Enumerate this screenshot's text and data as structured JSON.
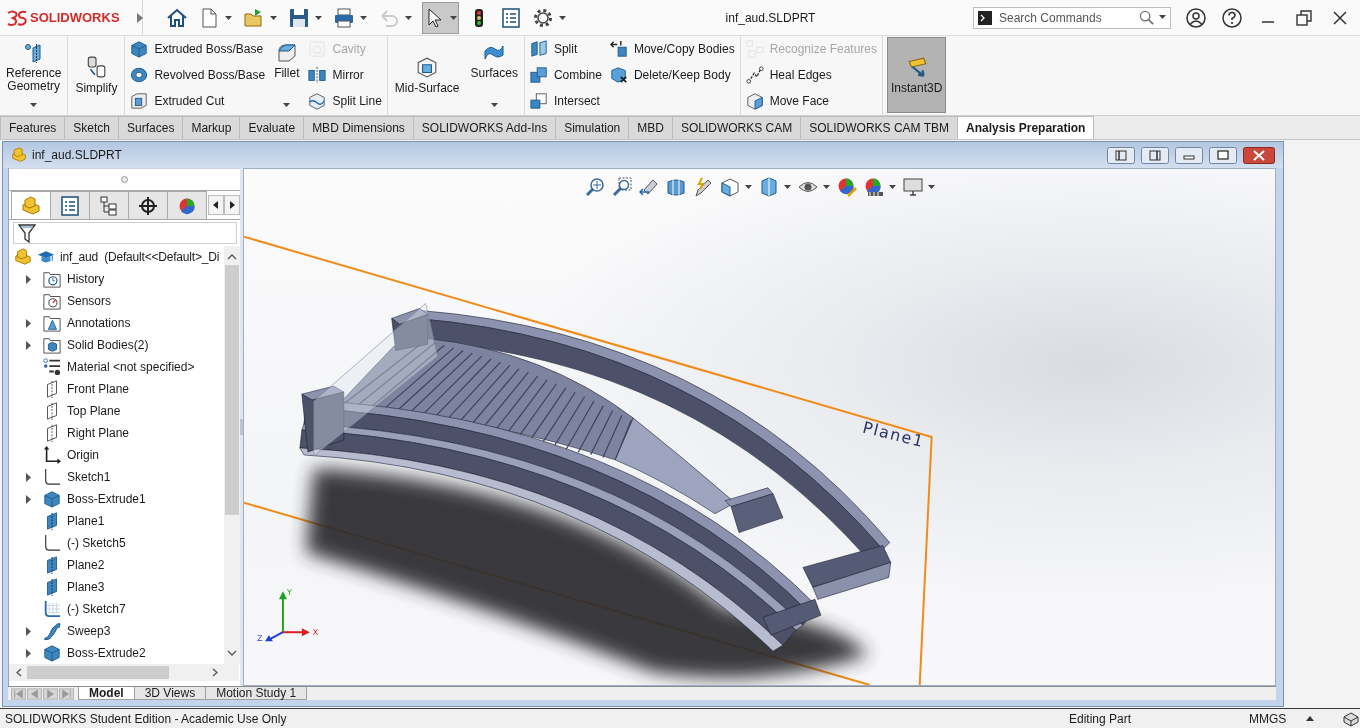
{
  "app": {
    "logo": "SOLIDWORKS",
    "quick_access": [
      {
        "kind": "home",
        "menu": false,
        "selected": false,
        "disabled": false
      },
      {
        "kind": "new",
        "menu": true,
        "selected": false,
        "disabled": false
      },
      {
        "kind": "open",
        "menu": true,
        "selected": false,
        "disabled": false
      },
      {
        "kind": "save",
        "menu": true,
        "selected": false,
        "disabled": false
      },
      {
        "kind": "print",
        "menu": true,
        "selected": false,
        "disabled": false
      },
      {
        "kind": "undo",
        "menu": true,
        "selected": false,
        "disabled": true
      },
      {
        "kind": "select",
        "menu": true,
        "selected": true,
        "disabled": false
      },
      {
        "kind": "rebuild",
        "menu": false,
        "selected": false,
        "disabled": false
      },
      {
        "kind": "file-properties",
        "menu": false,
        "selected": false,
        "disabled": false
      },
      {
        "kind": "options",
        "menu": true,
        "selected": false,
        "disabled": false
      }
    ],
    "document_title": "inf_aud.SLDPRT",
    "search": {
      "placeholder": "Search Commands"
    }
  },
  "ribbon": {
    "groups": [
      {
        "columns": [
          {
            "kind": "large",
            "commands": [
              {
                "label": "Reference Geometry",
                "kind": "reference-geometry",
                "disabled": false,
                "menu": true
              }
            ]
          }
        ]
      },
      {
        "columns": [
          {
            "kind": "large",
            "commands": [
              {
                "label": "Simplify",
                "kind": "simplify",
                "disabled": false,
                "menu": false
              }
            ]
          }
        ]
      },
      {
        "columns": [
          {
            "kind": "stack",
            "commands": [
              {
                "label": "Extruded Boss/Base",
                "kind": "extruded-boss",
                "disabled": false,
                "menu": false
              },
              {
                "label": "Revolved Boss/Base",
                "kind": "revolved-boss",
                "disabled": false,
                "menu": false
              },
              {
                "label": "Extruded Cut",
                "kind": "extruded-cut",
                "disabled": false,
                "menu": false
              }
            ]
          },
          {
            "kind": "large",
            "commands": [
              {
                "label": "Fillet",
                "kind": "fillet",
                "disabled": false,
                "menu": true
              }
            ]
          },
          {
            "kind": "stack",
            "commands": [
              {
                "label": "Cavity",
                "kind": "cavity",
                "disabled": true,
                "menu": false
              },
              {
                "label": "Mirror",
                "kind": "mirror",
                "disabled": false,
                "menu": false
              },
              {
                "label": "Split Line",
                "kind": "split-line",
                "disabled": false,
                "menu": false
              }
            ]
          }
        ]
      },
      {
        "columns": [
          {
            "kind": "large",
            "commands": [
              {
                "label": "Mid-Surface",
                "kind": "mid-surface",
                "disabled": false,
                "menu": false
              }
            ]
          },
          {
            "kind": "large",
            "commands": [
              {
                "label": "Surfaces",
                "kind": "surfaces",
                "disabled": false,
                "menu": true
              }
            ]
          }
        ]
      },
      {
        "columns": [
          {
            "kind": "stack",
            "commands": [
              {
                "label": "Split",
                "kind": "split",
                "disabled": false,
                "menu": false
              },
              {
                "label": "Combine",
                "kind": "combine",
                "disabled": false,
                "menu": false
              },
              {
                "label": "Intersect",
                "kind": "intersect",
                "disabled": false,
                "menu": false
              }
            ]
          },
          {
            "kind": "stack",
            "commands": [
              {
                "label": "Move/Copy Bodies",
                "kind": "move-copy",
                "disabled": false,
                "menu": false
              },
              {
                "label": "Delete/Keep Body",
                "kind": "delete-keep",
                "disabled": false,
                "menu": false
              }
            ]
          }
        ]
      },
      {
        "columns": [
          {
            "kind": "stack",
            "commands": [
              {
                "label": "Recognize Features",
                "kind": "recognize",
                "disabled": true,
                "menu": false
              },
              {
                "label": "Heal Edges",
                "kind": "heal-edges",
                "disabled": false,
                "menu": false
              },
              {
                "label": "Move Face",
                "kind": "move-face",
                "disabled": false,
                "menu": false
              }
            ]
          }
        ]
      },
      {
        "columns": [
          {
            "kind": "large",
            "commands": [
              {
                "label": "Instant3D",
                "kind": "instant3d",
                "disabled": false,
                "menu": false,
                "on": true
              }
            ]
          }
        ]
      }
    ]
  },
  "command_tabs": [
    {
      "label": "Features",
      "selected": false
    },
    {
      "label": "Sketch",
      "selected": false
    },
    {
      "label": "Surfaces",
      "selected": false
    },
    {
      "label": "Markup",
      "selected": false
    },
    {
      "label": "Evaluate",
      "selected": false
    },
    {
      "label": "MBD Dimensions",
      "selected": false
    },
    {
      "label": "SOLIDWORKS Add-Ins",
      "selected": false
    },
    {
      "label": "Simulation",
      "selected": false
    },
    {
      "label": "MBD",
      "selected": false
    },
    {
      "label": "SOLIDWORKS CAM",
      "selected": false
    },
    {
      "label": "SOLIDWORKS CAM TBM",
      "selected": false
    },
    {
      "label": "Analysis Preparation",
      "selected": true
    }
  ],
  "document": {
    "title": "inf_aud.SLDPRT",
    "feature_manager": {
      "tabs": [
        {
          "kind": "feature-tree",
          "selected": true
        },
        {
          "kind": "property-manager",
          "selected": false
        },
        {
          "kind": "configuration-manager",
          "selected": false
        },
        {
          "kind": "dimxpert",
          "selected": false
        },
        {
          "kind": "display-manager",
          "selected": false
        }
      ],
      "tree": {
        "label": "inf_aud  (Default<<Default>_Di",
        "kind": "part",
        "children": [
          {
            "label": "History",
            "kind": "history",
            "expandable": true
          },
          {
            "label": "Sensors",
            "kind": "sensors",
            "expandable": false
          },
          {
            "label": "Annotations",
            "kind": "annotations",
            "expandable": true
          },
          {
            "label": "Solid Bodies(2)",
            "kind": "bodies",
            "expandable": true
          },
          {
            "label": "Material <not specified>",
            "kind": "material",
            "expandable": false
          },
          {
            "label": "Front Plane",
            "kind": "plane-outline",
            "expandable": false
          },
          {
            "label": "Top Plane",
            "kind": "plane-outline",
            "expandable": false
          },
          {
            "label": "Right Plane",
            "kind": "plane-outline",
            "expandable": false
          },
          {
            "label": "Origin",
            "kind": "origin",
            "expandable": false
          },
          {
            "label": "Sketch1",
            "kind": "sketch",
            "expandable": true
          },
          {
            "label": "Boss-Extrude1",
            "kind": "extrude",
            "expandable": true
          },
          {
            "label": "Plane1",
            "kind": "plane",
            "expandable": false
          },
          {
            "label": "(-) Sketch5",
            "kind": "sketch",
            "expandable": false
          },
          {
            "label": "Plane2",
            "kind": "plane",
            "expandable": false
          },
          {
            "label": "Plane3",
            "kind": "plane",
            "expandable": false
          },
          {
            "label": "(-) Sketch7",
            "kind": "sketch-3d",
            "expandable": false
          },
          {
            "label": "Sweep3",
            "kind": "sweep",
            "expandable": true
          },
          {
            "label": "Boss-Extrude2",
            "kind": "extrude",
            "expandable": true
          }
        ]
      }
    },
    "viewport": {
      "view_tools": [
        {
          "kind": "zoom-fit",
          "menu": false
        },
        {
          "kind": "zoom-area",
          "menu": false
        },
        {
          "kind": "previous-view",
          "menu": false
        },
        {
          "kind": "section-view",
          "menu": false
        },
        {
          "kind": "dynamic-annotation",
          "menu": false
        },
        {
          "kind": "view-orientation",
          "menu": true
        },
        {
          "kind": "display-style",
          "menu": true
        },
        {
          "kind": "hide-show",
          "menu": true
        },
        {
          "kind": "edit-appearance",
          "menu": false
        },
        {
          "kind": "apply-scene",
          "menu": true
        },
        {
          "kind": "view-settings",
          "menu": true
        }
      ],
      "plane_label": "Plane1",
      "triad": {
        "x": "X",
        "y": "Y",
        "z": "Z"
      }
    },
    "bottom_tabs": [
      {
        "label": "Model",
        "selected": true
      },
      {
        "label": "3D Views",
        "selected": false
      },
      {
        "label": "Motion Study 1",
        "selected": false
      }
    ]
  },
  "status_bar": {
    "edition": "SOLIDWORKS Student Edition - Academic Use Only",
    "mode": "Editing Part",
    "units": "MMGS"
  }
}
